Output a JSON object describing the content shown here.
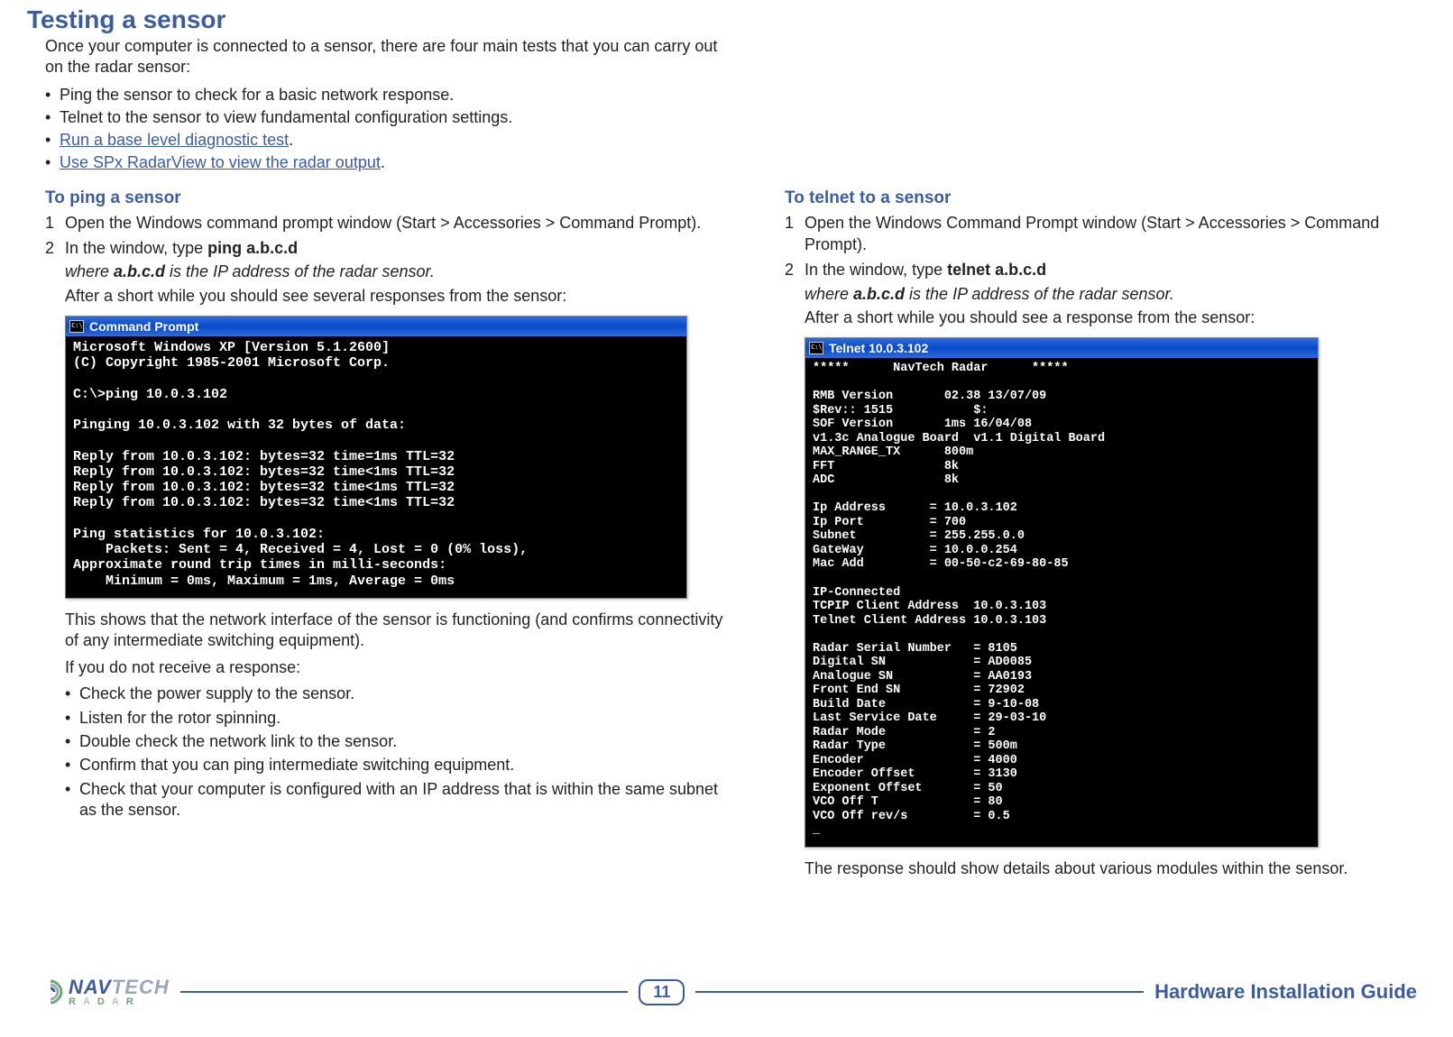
{
  "heading": "Testing a sensor",
  "intro": "Once your computer is connected to a sensor, there are four main tests that you can carry out on the radar sensor:",
  "bullets": [
    {
      "text": "Ping the sensor to check for a basic network response.",
      "link": false
    },
    {
      "text": "Telnet to the sensor to view fundamental configuration settings.",
      "link": false
    },
    {
      "text": "Run a base level diagnostic test",
      "link": true,
      "suffix": "."
    },
    {
      "text": "Use SPx RadarView to view the radar output",
      "link": true,
      "suffix": "."
    }
  ],
  "ping": {
    "heading": "To ping a sensor",
    "step1": "Open the Windows command prompt window (Start > Accessories > Command Prompt).",
    "step2a": "In the window, type ",
    "step2b": "ping a.b.c.d",
    "step2c_pre": "where ",
    "step2c_bold": "a.b.c.d",
    "step2c_post": " is the IP address of the radar sensor.",
    "step2d": "After a short while you should see several responses from the sensor:",
    "window_title": "Command Prompt",
    "terminal": "Microsoft Windows XP [Version 5.1.2600]\n(C) Copyright 1985-2001 Microsoft Corp.\n\nC:\\>ping 10.0.3.102\n\nPinging 10.0.3.102 with 32 bytes of data:\n\nReply from 10.0.3.102: bytes=32 time=1ms TTL=32\nReply from 10.0.3.102: bytes=32 time<1ms TTL=32\nReply from 10.0.3.102: bytes=32 time<1ms TTL=32\nReply from 10.0.3.102: bytes=32 time<1ms TTL=32\n\nPing statistics for 10.0.3.102:\n    Packets: Sent = 4, Received = 4, Lost = 0 (0% loss),\nApproximate round trip times in milli-seconds:\n    Minimum = 0ms, Maximum = 1ms, Average = 0ms",
    "after1": "This shows that the network interface of the sensor is functioning (and confirms connectivity of any intermediate switching equipment).",
    "after2": "If you do not receive a response:",
    "troubleshoot": [
      "Check the power supply to the sensor.",
      "Listen for the rotor spinning.",
      "Double check the network link to the sensor.",
      "Confirm that you can ping intermediate switching equipment.",
      "Check that your computer is configured with an IP address that is within the same subnet as the sensor."
    ]
  },
  "telnet": {
    "heading": "To telnet to a sensor",
    "step1": "Open the Windows Command Prompt window (Start > Accessories > Command Prompt).",
    "step2a": "In the window, type ",
    "step2b": "telnet a.b.c.d",
    "step2c_pre": "where ",
    "step2c_bold": "a.b.c.d",
    "step2c_post": " is the IP address of the radar sensor.",
    "step2d": "After a short while you should see a response from the sensor:",
    "window_title": "Telnet 10.0.3.102",
    "terminal": "*****      NavTech Radar      *****\n\nRMB Version       02.38 13/07/09\n$Rev:: 1515           $:\nSOF Version       1ms 16/04/08\nv1.3c Analogue Board  v1.1 Digital Board\nMAX_RANGE_TX      800m\nFFT               8k\nADC               8k\n\nIp Address      = 10.0.3.102\nIp Port         = 700\nSubnet          = 255.255.0.0\nGateWay         = 10.0.0.254\nMac Add         = 00-50-c2-69-80-85\n\nIP-Connected\nTCPIP Client Address  10.0.3.103\nTelnet Client Address 10.0.3.103\n\nRadar Serial Number   = 8105\nDigital SN            = AD0085\nAnalogue SN           = AA0193\nFront End SN          = 72902\nBuild Date            = 9-10-08\nLast Service Date     = 29-03-10\nRadar Mode            = 2\nRadar Type            = 500m\nEncoder               = 4000\nEncoder Offset        = 3130\nExponent Offset       = 50\nVCO Off T             = 80\nVCO Off rev/s         = 0.5\n_",
    "after": "The response should show details about various modules within the sensor."
  },
  "footer": {
    "page": "11",
    "title": "Hardware Installation Guide"
  }
}
